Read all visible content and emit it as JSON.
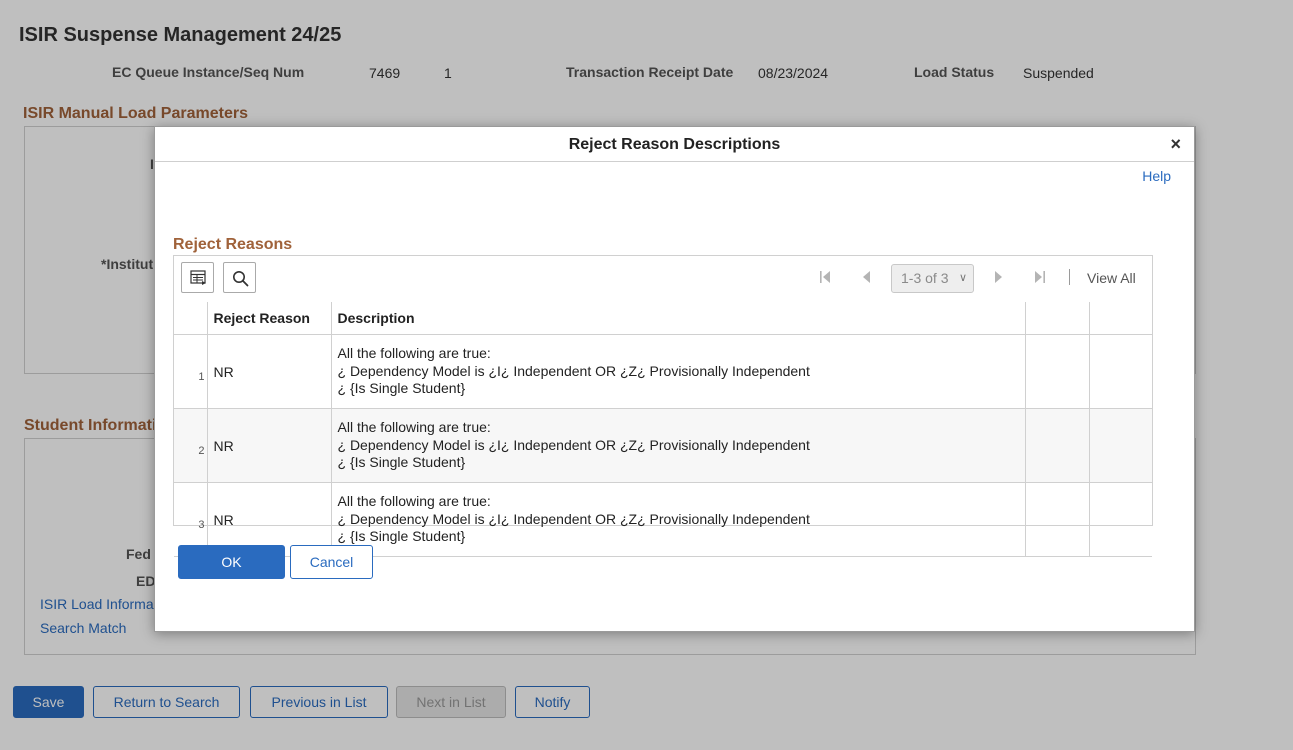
{
  "page": {
    "title": "ISIR Suspense Management 24/25",
    "header": {
      "ec_queue_label": "EC Queue Instance/Seq Num",
      "ec_queue_instance": "7469",
      "ec_queue_seq": "1",
      "receipt_date_label": "Transaction Receipt Date",
      "receipt_date": "08/23/2024",
      "load_status_label": "Load Status",
      "load_status": "Suspended"
    },
    "manual_load_section_title": "ISIR Manual Load Parameters",
    "manual_load_partial_label_1": "I",
    "manual_load_partial_label_2": "*Institut",
    "student_info_section_title": "Student Informati",
    "student_partial_label_1": "Fed",
    "student_partial_label_2": "ED",
    "isir_load_info_link": "ISIR Load Informa",
    "search_match_link": "Search Match",
    "bottom_buttons": {
      "save": "Save",
      "return_to_search": "Return to Search",
      "previous_in_list": "Previous in List",
      "next_in_list": "Next in List",
      "notify": "Notify"
    }
  },
  "modal": {
    "title": "Reject Reason Descriptions",
    "close_glyph": "×",
    "help": "Help",
    "grid_title": "Reject Reasons",
    "pager": {
      "range": "1-3 of 3",
      "view_all": "View All"
    },
    "columns": [
      "Reject Reason",
      "Description"
    ],
    "rows": [
      {
        "num": "1",
        "reason": "NR",
        "desc": [
          "All the following are true:",
          "¿ Dependency Model is ¿I¿ Independent OR ¿Z¿ Provisionally Independent",
          "¿ {Is Single Student}"
        ]
      },
      {
        "num": "2",
        "reason": "NR",
        "desc": [
          "All the following are true:",
          "¿ Dependency Model is ¿I¿ Independent OR ¿Z¿ Provisionally Independent",
          "¿ {Is Single Student}"
        ]
      },
      {
        "num": "3",
        "reason": "NR",
        "desc": [
          "All the following are true:",
          "¿ Dependency Model is ¿I¿ Independent OR ¿Z¿ Provisionally Independent",
          "¿ {Is Single Student}"
        ]
      }
    ],
    "ok": "OK",
    "cancel": "Cancel"
  },
  "icons": {
    "grid_personalize": "grid-personalize-icon",
    "search": "search-icon",
    "first": "first-page-icon",
    "previous": "previous-page-icon",
    "next": "next-page-icon",
    "last": "last-page-icon",
    "close": "close-icon"
  },
  "colors": {
    "accent": "#2a6bbf",
    "section_title": "#a0623a"
  }
}
